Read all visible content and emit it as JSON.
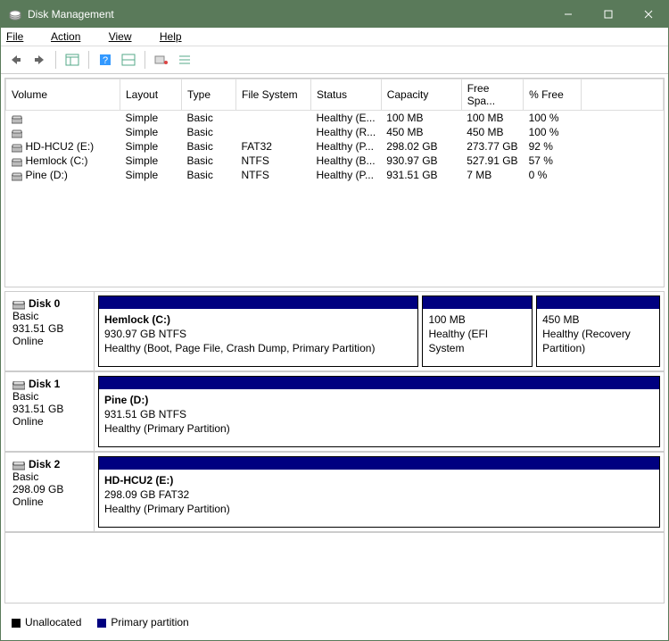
{
  "window": {
    "title": "Disk Management"
  },
  "menu": {
    "file": "File",
    "action": "Action",
    "view": "View",
    "help": "Help"
  },
  "columns": {
    "volume": "Volume",
    "layout": "Layout",
    "type": "Type",
    "filesystem": "File System",
    "status": "Status",
    "capacity": "Capacity",
    "freespace": "Free Spa...",
    "pctfree": "% Free"
  },
  "volumes": [
    {
      "name": "",
      "layout": "Simple",
      "type": "Basic",
      "fs": "",
      "status": "Healthy (E...",
      "cap": "100 MB",
      "free": "100 MB",
      "pct": "100 %"
    },
    {
      "name": "",
      "layout": "Simple",
      "type": "Basic",
      "fs": "",
      "status": "Healthy (R...",
      "cap": "450 MB",
      "free": "450 MB",
      "pct": "100 %"
    },
    {
      "name": "HD-HCU2 (E:)",
      "layout": "Simple",
      "type": "Basic",
      "fs": "FAT32",
      "status": "Healthy (P...",
      "cap": "298.02 GB",
      "free": "273.77 GB",
      "pct": "92 %"
    },
    {
      "name": "Hemlock (C:)",
      "layout": "Simple",
      "type": "Basic",
      "fs": "NTFS",
      "status": "Healthy (B...",
      "cap": "930.97 GB",
      "free": "527.91 GB",
      "pct": "57 %"
    },
    {
      "name": "Pine (D:)",
      "layout": "Simple",
      "type": "Basic",
      "fs": "NTFS",
      "status": "Healthy (P...",
      "cap": "931.51 GB",
      "free": "7 MB",
      "pct": "0 %"
    }
  ],
  "disks": [
    {
      "label": "Disk 0",
      "type": "Basic",
      "size": "931.51 GB",
      "status": "Online",
      "parts": [
        {
          "title": "Hemlock  (C:)",
          "line2": "930.97 GB NTFS",
          "line3": "Healthy (Boot, Page File, Crash Dump, Primary Partition)",
          "flex": "47"
        },
        {
          "title": "",
          "line2": "100 MB",
          "line3": "Healthy (EFI System",
          "flex": "16"
        },
        {
          "title": "",
          "line2": "450 MB",
          "line3": "Healthy (Recovery Partition)",
          "flex": "18"
        }
      ]
    },
    {
      "label": "Disk 1",
      "type": "Basic",
      "size": "931.51 GB",
      "status": "Online",
      "parts": [
        {
          "title": "Pine  (D:)",
          "line2": "931.51 GB NTFS",
          "line3": "Healthy (Primary Partition)",
          "flex": "81"
        }
      ]
    },
    {
      "label": "Disk 2",
      "type": "Basic",
      "size": "298.09 GB",
      "status": "Online",
      "parts": [
        {
          "title": "HD-HCU2  (E:)",
          "line2": "298.09 GB FAT32",
          "line3": "Healthy (Primary Partition)",
          "flex": "79"
        }
      ]
    }
  ],
  "legend": {
    "unallocated": "Unallocated",
    "primary": "Primary partition"
  }
}
